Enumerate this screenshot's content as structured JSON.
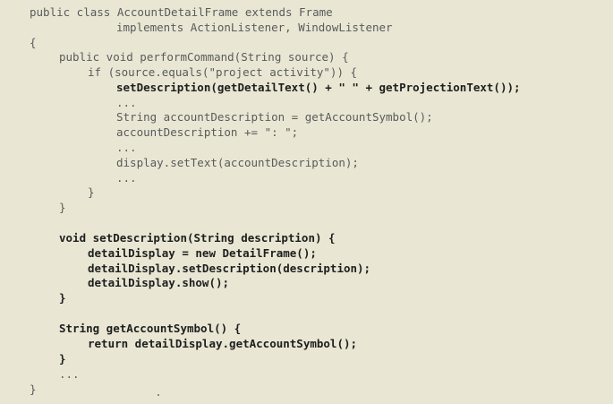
{
  "code_lines": [
    "public class AccountDetailFrame extends Frame",
    "implements ActionListener, WindowListener",
    "{",
    "public void performCommand(String source) {",
    "if (source.equals(\"project activity\")) {",
    "setDescription(getDetailText() + \" \" + getProjectionText());",
    "...",
    "String accountDescription = getAccountSymbol();",
    "accountDescription += \": \";",
    "...",
    "display.setText(accountDescription);",
    "...",
    "}",
    "}",
    "void setDescription(String description) {",
    "detailDisplay = new DetailFrame();",
    "detailDisplay.setDescription(description);",
    "detailDisplay.show();",
    "}",
    "String getAccountSymbol() {",
    "return detailDisplay.getAccountSymbol();",
    "}",
    "...",
    "}"
  ]
}
